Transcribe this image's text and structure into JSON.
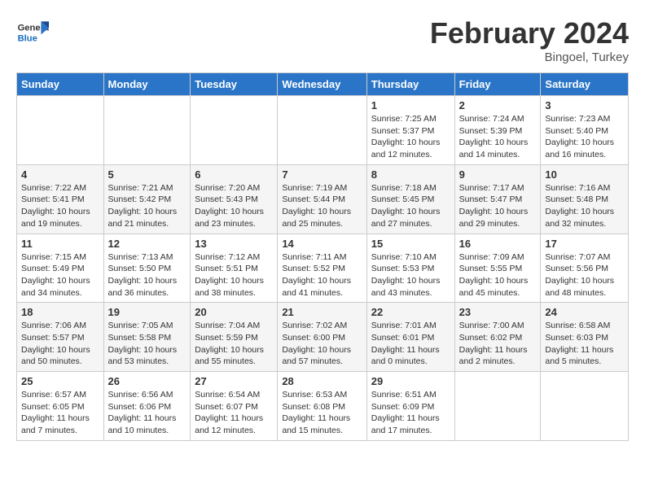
{
  "header": {
    "logo_line1": "General",
    "logo_line2": "Blue",
    "month": "February 2024",
    "location": "Bingoel, Turkey"
  },
  "weekdays": [
    "Sunday",
    "Monday",
    "Tuesday",
    "Wednesday",
    "Thursday",
    "Friday",
    "Saturday"
  ],
  "weeks": [
    [
      {
        "day": "",
        "sunrise": "",
        "sunset": "",
        "daylight": ""
      },
      {
        "day": "",
        "sunrise": "",
        "sunset": "",
        "daylight": ""
      },
      {
        "day": "",
        "sunrise": "",
        "sunset": "",
        "daylight": ""
      },
      {
        "day": "",
        "sunrise": "",
        "sunset": "",
        "daylight": ""
      },
      {
        "day": "1",
        "sunrise": "Sunrise: 7:25 AM",
        "sunset": "Sunset: 5:37 PM",
        "daylight": "Daylight: 10 hours and 12 minutes."
      },
      {
        "day": "2",
        "sunrise": "Sunrise: 7:24 AM",
        "sunset": "Sunset: 5:39 PM",
        "daylight": "Daylight: 10 hours and 14 minutes."
      },
      {
        "day": "3",
        "sunrise": "Sunrise: 7:23 AM",
        "sunset": "Sunset: 5:40 PM",
        "daylight": "Daylight: 10 hours and 16 minutes."
      }
    ],
    [
      {
        "day": "4",
        "sunrise": "Sunrise: 7:22 AM",
        "sunset": "Sunset: 5:41 PM",
        "daylight": "Daylight: 10 hours and 19 minutes."
      },
      {
        "day": "5",
        "sunrise": "Sunrise: 7:21 AM",
        "sunset": "Sunset: 5:42 PM",
        "daylight": "Daylight: 10 hours and 21 minutes."
      },
      {
        "day": "6",
        "sunrise": "Sunrise: 7:20 AM",
        "sunset": "Sunset: 5:43 PM",
        "daylight": "Daylight: 10 hours and 23 minutes."
      },
      {
        "day": "7",
        "sunrise": "Sunrise: 7:19 AM",
        "sunset": "Sunset: 5:44 PM",
        "daylight": "Daylight: 10 hours and 25 minutes."
      },
      {
        "day": "8",
        "sunrise": "Sunrise: 7:18 AM",
        "sunset": "Sunset: 5:45 PM",
        "daylight": "Daylight: 10 hours and 27 minutes."
      },
      {
        "day": "9",
        "sunrise": "Sunrise: 7:17 AM",
        "sunset": "Sunset: 5:47 PM",
        "daylight": "Daylight: 10 hours and 29 minutes."
      },
      {
        "day": "10",
        "sunrise": "Sunrise: 7:16 AM",
        "sunset": "Sunset: 5:48 PM",
        "daylight": "Daylight: 10 hours and 32 minutes."
      }
    ],
    [
      {
        "day": "11",
        "sunrise": "Sunrise: 7:15 AM",
        "sunset": "Sunset: 5:49 PM",
        "daylight": "Daylight: 10 hours and 34 minutes."
      },
      {
        "day": "12",
        "sunrise": "Sunrise: 7:13 AM",
        "sunset": "Sunset: 5:50 PM",
        "daylight": "Daylight: 10 hours and 36 minutes."
      },
      {
        "day": "13",
        "sunrise": "Sunrise: 7:12 AM",
        "sunset": "Sunset: 5:51 PM",
        "daylight": "Daylight: 10 hours and 38 minutes."
      },
      {
        "day": "14",
        "sunrise": "Sunrise: 7:11 AM",
        "sunset": "Sunset: 5:52 PM",
        "daylight": "Daylight: 10 hours and 41 minutes."
      },
      {
        "day": "15",
        "sunrise": "Sunrise: 7:10 AM",
        "sunset": "Sunset: 5:53 PM",
        "daylight": "Daylight: 10 hours and 43 minutes."
      },
      {
        "day": "16",
        "sunrise": "Sunrise: 7:09 AM",
        "sunset": "Sunset: 5:55 PM",
        "daylight": "Daylight: 10 hours and 45 minutes."
      },
      {
        "day": "17",
        "sunrise": "Sunrise: 7:07 AM",
        "sunset": "Sunset: 5:56 PM",
        "daylight": "Daylight: 10 hours and 48 minutes."
      }
    ],
    [
      {
        "day": "18",
        "sunrise": "Sunrise: 7:06 AM",
        "sunset": "Sunset: 5:57 PM",
        "daylight": "Daylight: 10 hours and 50 minutes."
      },
      {
        "day": "19",
        "sunrise": "Sunrise: 7:05 AM",
        "sunset": "Sunset: 5:58 PM",
        "daylight": "Daylight: 10 hours and 53 minutes."
      },
      {
        "day": "20",
        "sunrise": "Sunrise: 7:04 AM",
        "sunset": "Sunset: 5:59 PM",
        "daylight": "Daylight: 10 hours and 55 minutes."
      },
      {
        "day": "21",
        "sunrise": "Sunrise: 7:02 AM",
        "sunset": "Sunset: 6:00 PM",
        "daylight": "Daylight: 10 hours and 57 minutes."
      },
      {
        "day": "22",
        "sunrise": "Sunrise: 7:01 AM",
        "sunset": "Sunset: 6:01 PM",
        "daylight": "Daylight: 11 hours and 0 minutes."
      },
      {
        "day": "23",
        "sunrise": "Sunrise: 7:00 AM",
        "sunset": "Sunset: 6:02 PM",
        "daylight": "Daylight: 11 hours and 2 minutes."
      },
      {
        "day": "24",
        "sunrise": "Sunrise: 6:58 AM",
        "sunset": "Sunset: 6:03 PM",
        "daylight": "Daylight: 11 hours and 5 minutes."
      }
    ],
    [
      {
        "day": "25",
        "sunrise": "Sunrise: 6:57 AM",
        "sunset": "Sunset: 6:05 PM",
        "daylight": "Daylight: 11 hours and 7 minutes."
      },
      {
        "day": "26",
        "sunrise": "Sunrise: 6:56 AM",
        "sunset": "Sunset: 6:06 PM",
        "daylight": "Daylight: 11 hours and 10 minutes."
      },
      {
        "day": "27",
        "sunrise": "Sunrise: 6:54 AM",
        "sunset": "Sunset: 6:07 PM",
        "daylight": "Daylight: 11 hours and 12 minutes."
      },
      {
        "day": "28",
        "sunrise": "Sunrise: 6:53 AM",
        "sunset": "Sunset: 6:08 PM",
        "daylight": "Daylight: 11 hours and 15 minutes."
      },
      {
        "day": "29",
        "sunrise": "Sunrise: 6:51 AM",
        "sunset": "Sunset: 6:09 PM",
        "daylight": "Daylight: 11 hours and 17 minutes."
      },
      {
        "day": "",
        "sunrise": "",
        "sunset": "",
        "daylight": ""
      },
      {
        "day": "",
        "sunrise": "",
        "sunset": "",
        "daylight": ""
      }
    ]
  ]
}
